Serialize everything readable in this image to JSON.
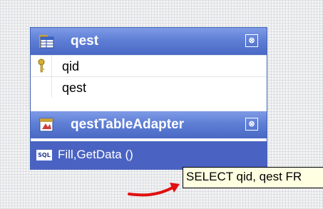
{
  "dataset": {
    "table": {
      "name": "qest",
      "header_icon": "table-icon",
      "collapse_glyph": "⊗",
      "key_icon": "primary-key-icon",
      "columns": [
        "qid",
        "qest"
      ]
    },
    "adapter": {
      "name": "qestTableAdapter",
      "header_icon": "table-adapter-icon",
      "collapse_glyph": "⊗",
      "sql_badge": "SQL",
      "method": "Fill,GetData ()"
    }
  },
  "tooltip": {
    "text": "SELECT qid, qest FR"
  },
  "colors": {
    "header_gradient_top": "#7f9be6",
    "header_gradient_bottom": "#4a68c4",
    "method_selected": "#4a63c2",
    "tooltip_bg": "#ffffe1",
    "annotation_arrow": "#e01010"
  }
}
